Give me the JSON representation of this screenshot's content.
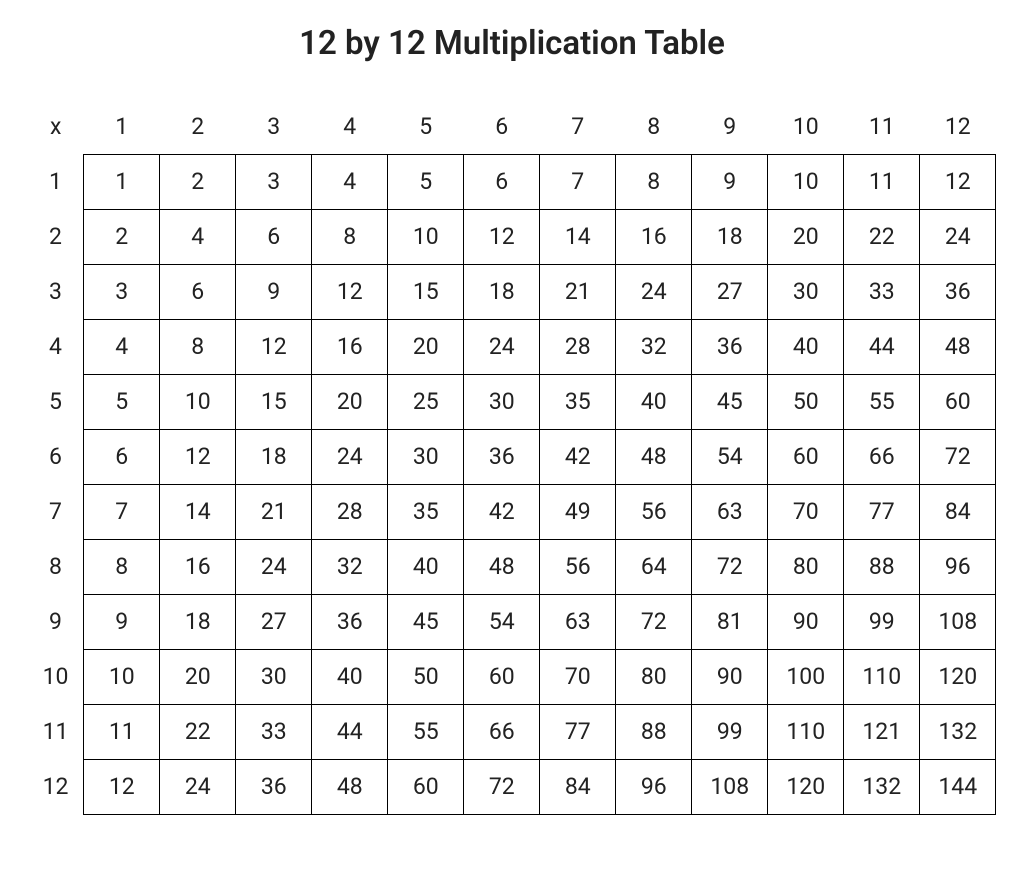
{
  "title": "12 by 12 Multiplication Table",
  "corner_label": "x",
  "col_headers": [
    "1",
    "2",
    "3",
    "4",
    "5",
    "6",
    "7",
    "8",
    "9",
    "10",
    "11",
    "12"
  ],
  "row_headers": [
    "1",
    "2",
    "3",
    "4",
    "5",
    "6",
    "7",
    "8",
    "9",
    "10",
    "11",
    "12"
  ],
  "rows": [
    [
      "1",
      "2",
      "3",
      "4",
      "5",
      "6",
      "7",
      "8",
      "9",
      "10",
      "11",
      "12"
    ],
    [
      "2",
      "4",
      "6",
      "8",
      "10",
      "12",
      "14",
      "16",
      "18",
      "20",
      "22",
      "24"
    ],
    [
      "3",
      "6",
      "9",
      "12",
      "15",
      "18",
      "21",
      "24",
      "27",
      "30",
      "33",
      "36"
    ],
    [
      "4",
      "8",
      "12",
      "16",
      "20",
      "24",
      "28",
      "32",
      "36",
      "40",
      "44",
      "48"
    ],
    [
      "5",
      "10",
      "15",
      "20",
      "25",
      "30",
      "35",
      "40",
      "45",
      "50",
      "55",
      "60"
    ],
    [
      "6",
      "12",
      "18",
      "24",
      "30",
      "36",
      "42",
      "48",
      "54",
      "60",
      "66",
      "72"
    ],
    [
      "7",
      "14",
      "21",
      "28",
      "35",
      "42",
      "49",
      "56",
      "63",
      "70",
      "77",
      "84"
    ],
    [
      "8",
      "16",
      "24",
      "32",
      "40",
      "48",
      "56",
      "64",
      "72",
      "80",
      "88",
      "96"
    ],
    [
      "9",
      "18",
      "27",
      "36",
      "45",
      "54",
      "63",
      "72",
      "81",
      "90",
      "99",
      "108"
    ],
    [
      "10",
      "20",
      "30",
      "40",
      "50",
      "60",
      "70",
      "80",
      "90",
      "100",
      "110",
      "120"
    ],
    [
      "11",
      "22",
      "33",
      "44",
      "55",
      "66",
      "77",
      "88",
      "99",
      "110",
      "121",
      "132"
    ],
    [
      "12",
      "24",
      "36",
      "48",
      "60",
      "72",
      "84",
      "96",
      "108",
      "120",
      "132",
      "144"
    ]
  ],
  "chart_data": {
    "type": "table",
    "title": "12 by 12 Multiplication Table",
    "columns": [
      1,
      2,
      3,
      4,
      5,
      6,
      7,
      8,
      9,
      10,
      11,
      12
    ],
    "rows": [
      1,
      2,
      3,
      4,
      5,
      6,
      7,
      8,
      9,
      10,
      11,
      12
    ],
    "values": [
      [
        1,
        2,
        3,
        4,
        5,
        6,
        7,
        8,
        9,
        10,
        11,
        12
      ],
      [
        2,
        4,
        6,
        8,
        10,
        12,
        14,
        16,
        18,
        20,
        22,
        24
      ],
      [
        3,
        6,
        9,
        12,
        15,
        18,
        21,
        24,
        27,
        30,
        33,
        36
      ],
      [
        4,
        8,
        12,
        16,
        20,
        24,
        28,
        32,
        36,
        40,
        44,
        48
      ],
      [
        5,
        10,
        15,
        20,
        25,
        30,
        35,
        40,
        45,
        50,
        55,
        60
      ],
      [
        6,
        12,
        18,
        24,
        30,
        36,
        42,
        48,
        54,
        60,
        66,
        72
      ],
      [
        7,
        14,
        21,
        28,
        35,
        42,
        49,
        56,
        63,
        70,
        77,
        84
      ],
      [
        8,
        16,
        24,
        32,
        40,
        48,
        56,
        64,
        72,
        80,
        88,
        96
      ],
      [
        9,
        18,
        27,
        36,
        45,
        54,
        63,
        72,
        81,
        90,
        99,
        108
      ],
      [
        10,
        20,
        30,
        40,
        50,
        60,
        70,
        80,
        90,
        100,
        110,
        120
      ],
      [
        11,
        22,
        33,
        44,
        55,
        66,
        77,
        88,
        99,
        110,
        121,
        132
      ],
      [
        12,
        24,
        36,
        48,
        60,
        72,
        84,
        96,
        108,
        120,
        132,
        144
      ]
    ]
  }
}
